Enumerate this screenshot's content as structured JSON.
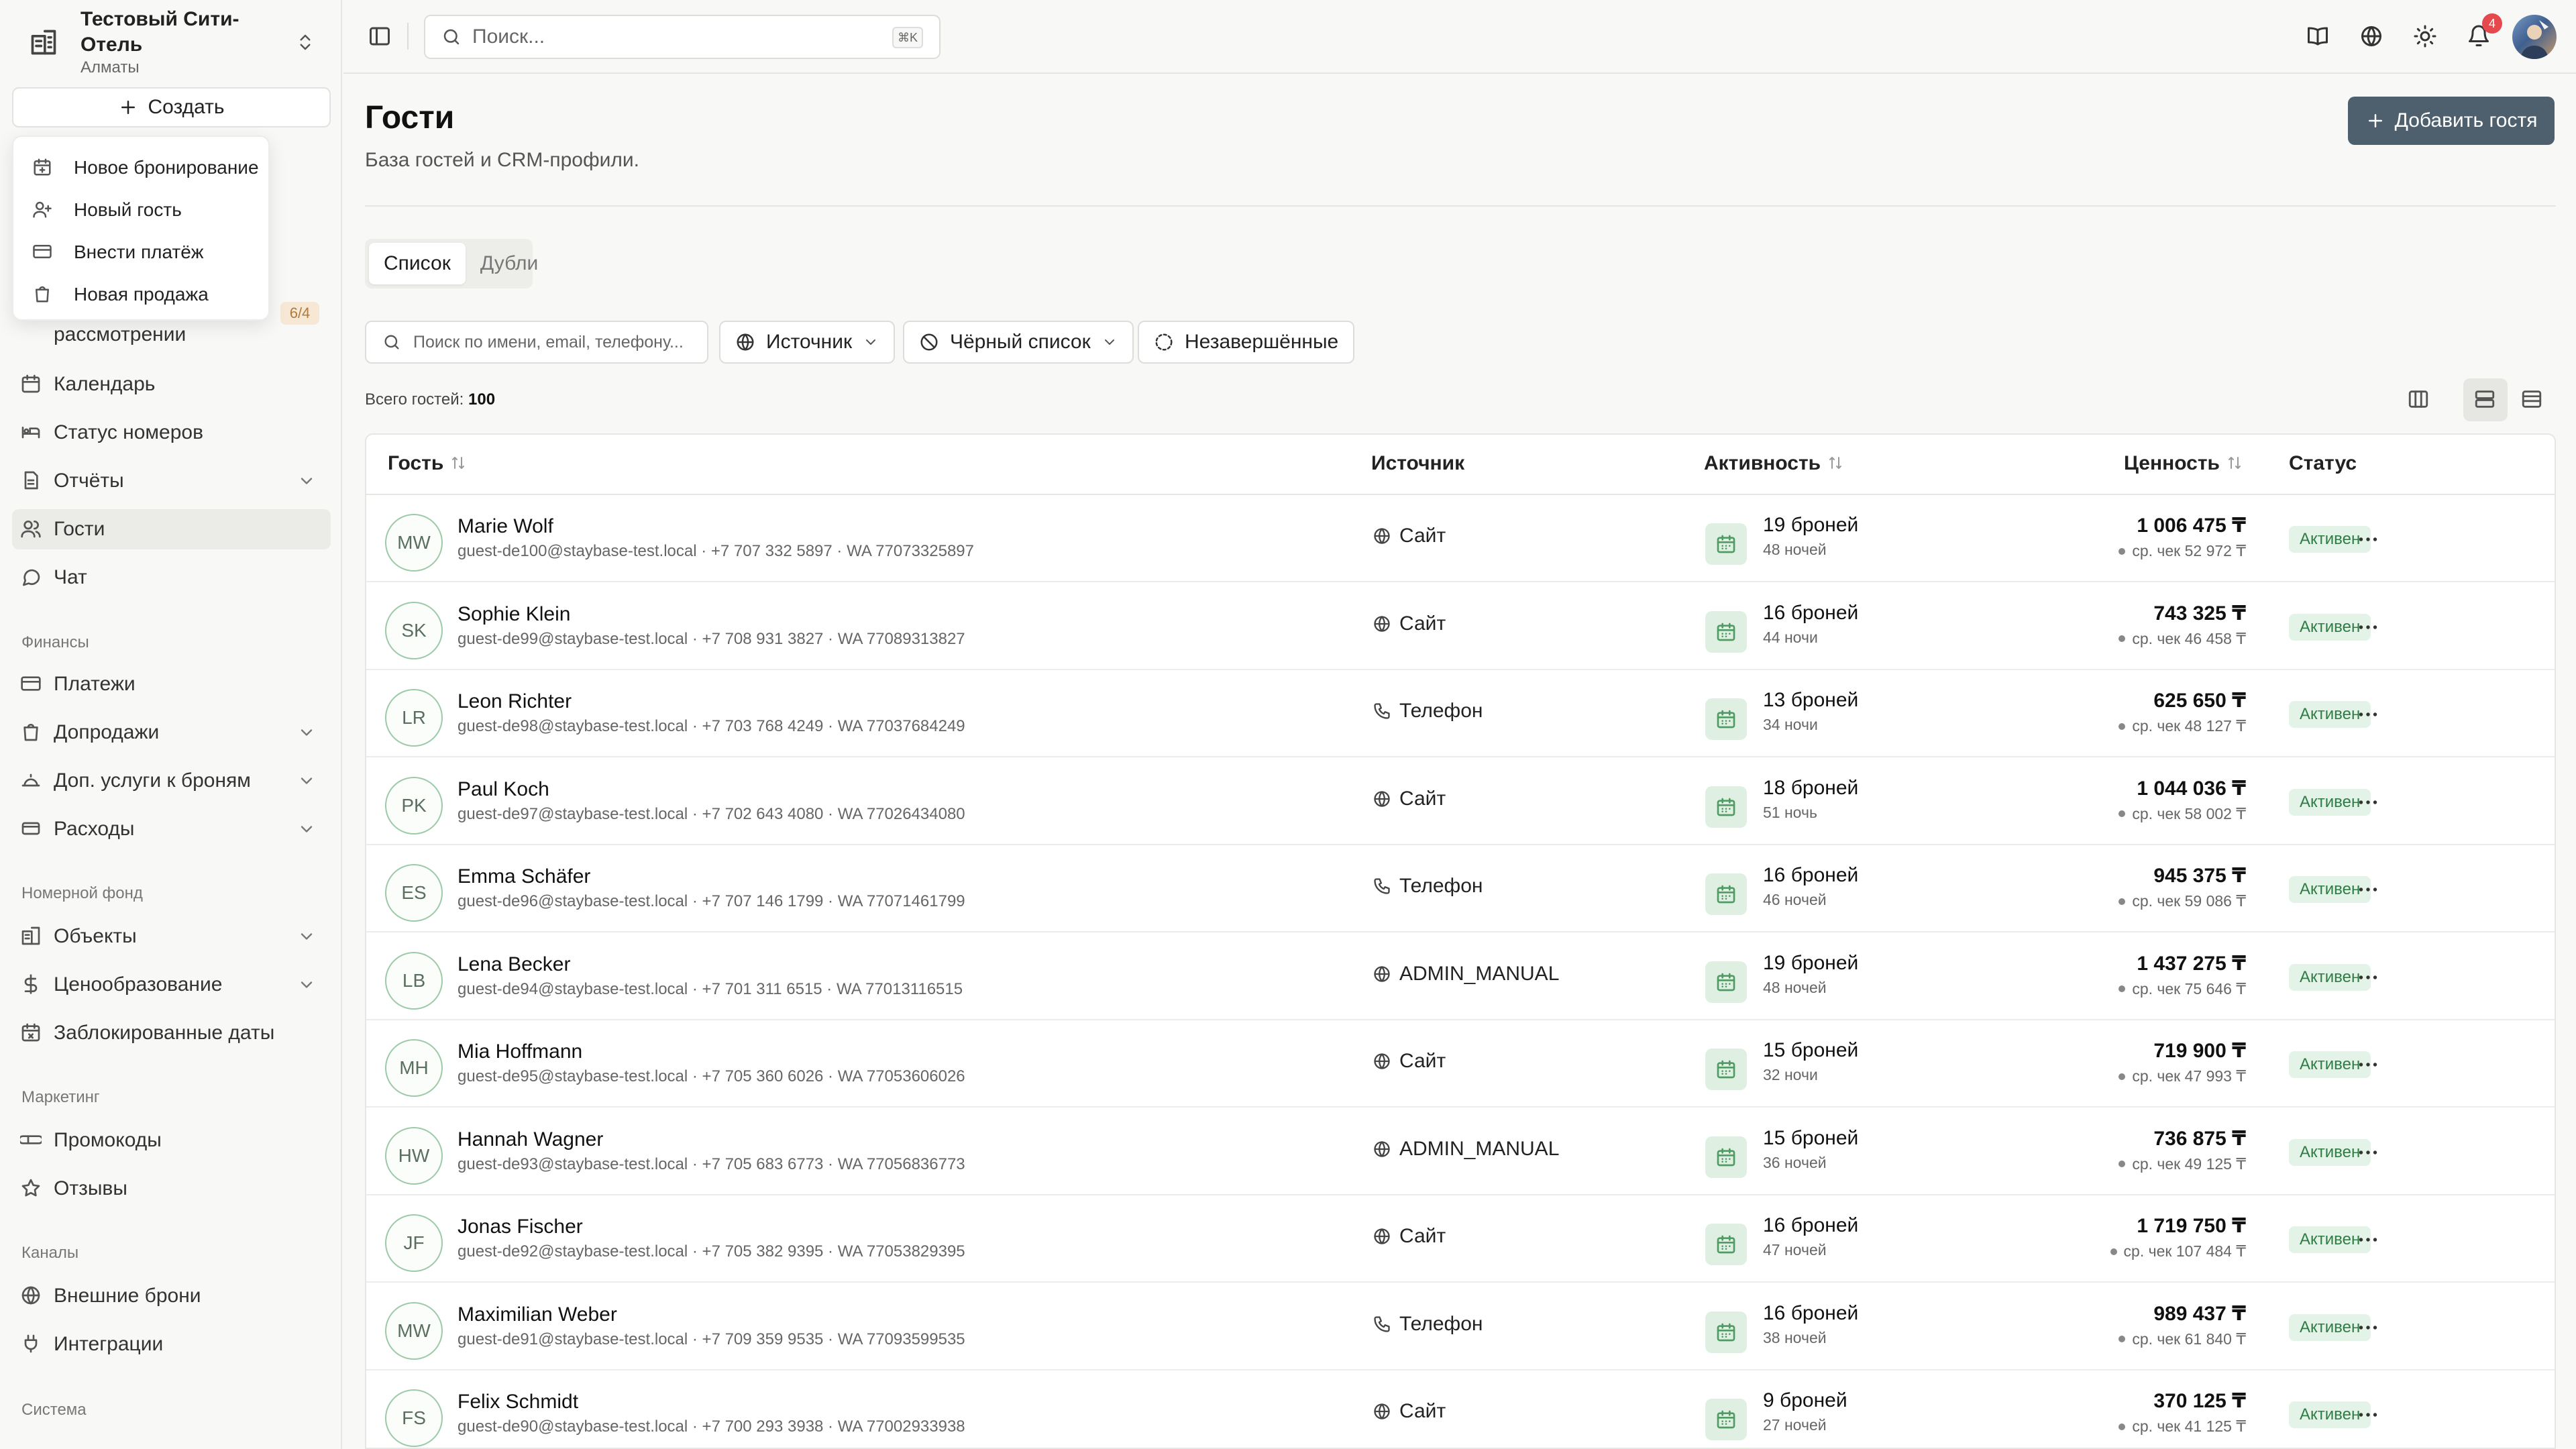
{
  "hotel": {
    "name": "Тестовый Сити-Отель",
    "city": "Алматы"
  },
  "sidebar": {
    "create_label": "Создать",
    "dropdown": [
      {
        "label": "Новое бронирование",
        "icon": "calendar-plus-icon"
      },
      {
        "label": "Новый гость",
        "icon": "user-plus-icon"
      },
      {
        "label": "Внести платёж",
        "icon": "credit-card-icon"
      },
      {
        "label": "Новая продажа",
        "icon": "shopping-bag-icon"
      }
    ],
    "partial_item": "рассмотрении",
    "partial_badge": "6/4",
    "items": [
      {
        "label": "Календарь"
      },
      {
        "label": "Статус номеров"
      },
      {
        "label": "Отчёты"
      },
      {
        "label": "Гости"
      },
      {
        "label": "Чат"
      }
    ],
    "sections": {
      "finance": "Финансы",
      "rooms": "Номерной фонд",
      "marketing": "Маркетинг",
      "channels": "Каналы",
      "system": "Система"
    },
    "finance_items": [
      {
        "label": "Платежи"
      },
      {
        "label": "Допродажи"
      },
      {
        "label": "Доп. услуги к броням"
      },
      {
        "label": "Расходы"
      }
    ],
    "rooms_items": [
      {
        "label": "Объекты"
      },
      {
        "label": "Ценообразование"
      },
      {
        "label": "Заблокированные даты"
      }
    ],
    "marketing_items": [
      {
        "label": "Промокоды"
      },
      {
        "label": "Отзывы"
      }
    ],
    "channels_items": [
      {
        "label": "Внешние брони"
      },
      {
        "label": "Интеграции"
      }
    ]
  },
  "topbar": {
    "search_placeholder": "Поиск...",
    "search_shortcut": "⌘K",
    "notifications_count": "4"
  },
  "page": {
    "title": "Гости",
    "subtitle": "База гостей и CRM-профили.",
    "add_button": "Добавить гостя",
    "tabs": [
      "Список",
      "Дубли"
    ],
    "filter_search_placeholder": "Поиск по имени, email, телефону...",
    "filter_source": "Источник",
    "filter_blacklist": "Чёрный список",
    "filter_incomplete": "Незавершённые",
    "total_label": "Всего гостей:",
    "total_value": "100"
  },
  "table": {
    "headers": {
      "guest": "Гость",
      "source": "Источник",
      "activity": "Активность",
      "value": "Ценность",
      "status": "Статус"
    },
    "rows": [
      {
        "initials": "MW",
        "name": "Marie Wolf",
        "contact": "guest-de100@staybase-test.local · +7 707 332 5897 · WA 77073325897",
        "source": "Сайт",
        "source_icon": "globe-icon",
        "bookings": "19 броней",
        "nights": "48 ночей",
        "value": "1 006 475 ₸",
        "avg": "ср. чек 52 972 ₸",
        "status": "Активен"
      },
      {
        "initials": "SK",
        "name": "Sophie Klein",
        "contact": "guest-de99@staybase-test.local · +7 708 931 3827 · WA 77089313827",
        "source": "Сайт",
        "source_icon": "globe-icon",
        "bookings": "16 броней",
        "nights": "44 ночи",
        "value": "743 325 ₸",
        "avg": "ср. чек 46 458 ₸",
        "status": "Активен"
      },
      {
        "initials": "LR",
        "name": "Leon Richter",
        "contact": "guest-de98@staybase-test.local · +7 703 768 4249 · WA 77037684249",
        "source": "Телефон",
        "source_icon": "phone-icon",
        "bookings": "13 броней",
        "nights": "34 ночи",
        "value": "625 650 ₸",
        "avg": "ср. чек 48 127 ₸",
        "status": "Активен"
      },
      {
        "initials": "PK",
        "name": "Paul Koch",
        "contact": "guest-de97@staybase-test.local · +7 702 643 4080 · WA 77026434080",
        "source": "Сайт",
        "source_icon": "globe-icon",
        "bookings": "18 броней",
        "nights": "51 ночь",
        "value": "1 044 036 ₸",
        "avg": "ср. чек 58 002 ₸",
        "status": "Активен"
      },
      {
        "initials": "ES",
        "name": "Emma Schäfer",
        "contact": "guest-de96@staybase-test.local · +7 707 146 1799 · WA 77071461799",
        "source": "Телефон",
        "source_icon": "phone-icon",
        "bookings": "16 броней",
        "nights": "46 ночей",
        "value": "945 375 ₸",
        "avg": "ср. чек 59 086 ₸",
        "status": "Активен"
      },
      {
        "initials": "LB",
        "name": "Lena Becker",
        "contact": "guest-de94@staybase-test.local · +7 701 311 6515 · WA 77013116515",
        "source": "ADMIN_MANUAL",
        "source_icon": "globe-icon",
        "bookings": "19 броней",
        "nights": "48 ночей",
        "value": "1 437 275 ₸",
        "avg": "ср. чек 75 646 ₸",
        "status": "Активен"
      },
      {
        "initials": "MH",
        "name": "Mia Hoffmann",
        "contact": "guest-de95@staybase-test.local · +7 705 360 6026 · WA 77053606026",
        "source": "Сайт",
        "source_icon": "globe-icon",
        "bookings": "15 броней",
        "nights": "32 ночи",
        "value": "719 900 ₸",
        "avg": "ср. чек 47 993 ₸",
        "status": "Активен"
      },
      {
        "initials": "HW",
        "name": "Hannah Wagner",
        "contact": "guest-de93@staybase-test.local · +7 705 683 6773 · WA 77056836773",
        "source": "ADMIN_MANUAL",
        "source_icon": "globe-icon",
        "bookings": "15 броней",
        "nights": "36 ночей",
        "value": "736 875 ₸",
        "avg": "ср. чек 49 125 ₸",
        "status": "Активен"
      },
      {
        "initials": "JF",
        "name": "Jonas Fischer",
        "contact": "guest-de92@staybase-test.local · +7 705 382 9395 · WA 77053829395",
        "source": "Сайт",
        "source_icon": "globe-icon",
        "bookings": "16 броней",
        "nights": "47 ночей",
        "value": "1 719 750 ₸",
        "avg": "ср. чек 107 484 ₸",
        "status": "Активен"
      },
      {
        "initials": "MW",
        "name": "Maximilian Weber",
        "contact": "guest-de91@staybase-test.local · +7 709 359 9535 · WA 77093599535",
        "source": "Телефон",
        "source_icon": "phone-icon",
        "bookings": "16 броней",
        "nights": "38 ночей",
        "value": "989 437 ₸",
        "avg": "ср. чек 61 840 ₸",
        "status": "Активен"
      },
      {
        "initials": "FS",
        "name": "Felix Schmidt",
        "contact": "guest-de90@staybase-test.local · +7 700 293 3938 · WA 77002933938",
        "source": "Сайт",
        "source_icon": "globe-icon",
        "bookings": "9 броней",
        "nights": "27 ночей",
        "value": "370 125 ₸",
        "avg": "ср. чек 41 125 ₸",
        "status": "Активен"
      }
    ]
  },
  "colors": {
    "accent_button": "#4e5f6e",
    "status_bg": "#e4f3e7",
    "status_text": "#2f7d45",
    "avatar_ring": "#9cc9a8",
    "notification": "#e5484d"
  }
}
